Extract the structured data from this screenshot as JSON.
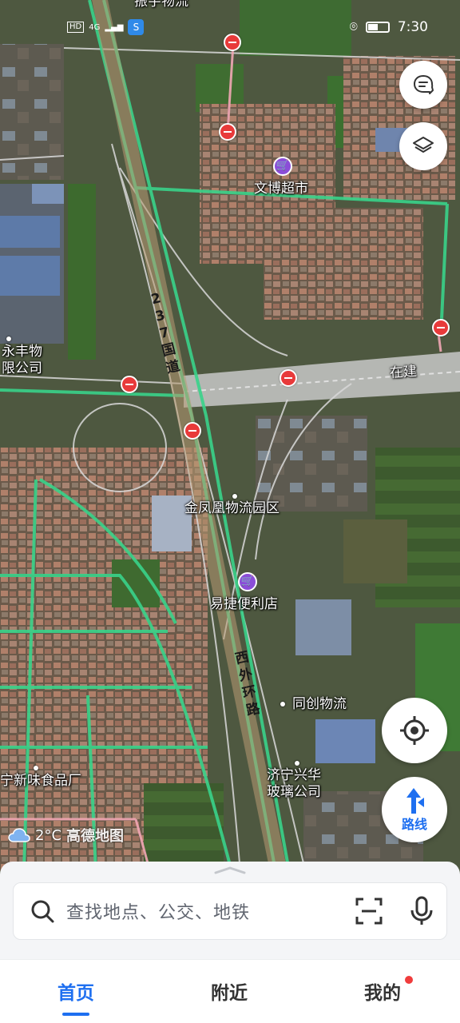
{
  "status_bar": {
    "network": "4G",
    "hd": "HD",
    "time": "7:30"
  },
  "map": {
    "top_partial_label": "振宇物流",
    "pois": [
      {
        "name": "文博超市"
      },
      {
        "name": "永丰物限公司"
      },
      {
        "name": "金凤凰物流园区"
      },
      {
        "name": "易捷便利店"
      },
      {
        "name": "同创物流"
      },
      {
        "name": "宁新味食品厂"
      },
      {
        "name": "济宁兴华玻璃公司"
      }
    ],
    "roads": {
      "national_road": "237国道",
      "west_ring": "西外环路",
      "under_construction": "在建"
    }
  },
  "weather": {
    "temperature": "2°C",
    "brand": "高德地图"
  },
  "buttons": {
    "route_label": "路线"
  },
  "search": {
    "placeholder": "查找地点、公交、地铁"
  },
  "tabs": [
    {
      "label": "首页",
      "active": true
    },
    {
      "label": "附近",
      "active": false
    },
    {
      "label": "我的",
      "active": false,
      "badge": true
    }
  ],
  "colors": {
    "accent": "#1e6ff0",
    "road_green": "#39d38a",
    "shop_pin": "#8b4dd8",
    "no_entry": "#e83a3a"
  }
}
